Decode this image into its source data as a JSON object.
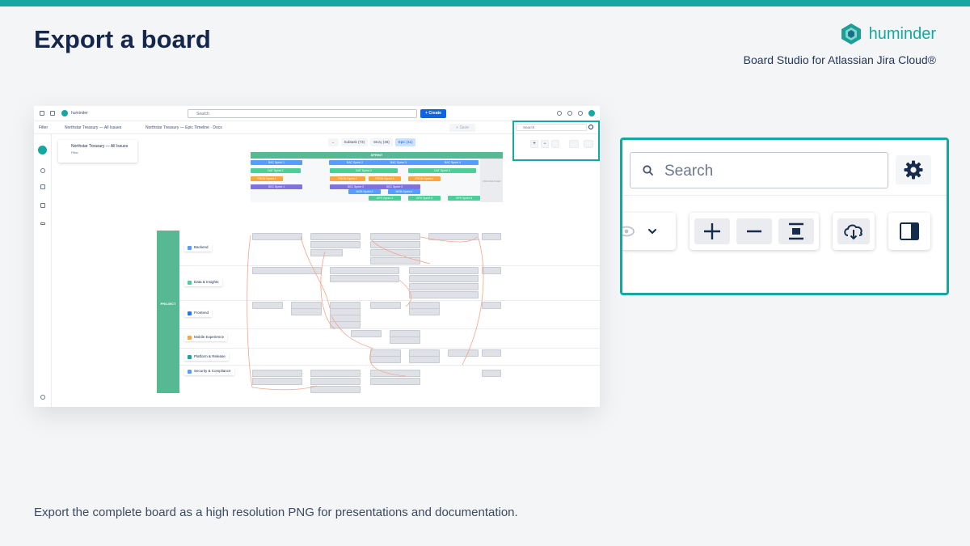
{
  "page": {
    "title": "Export a board",
    "brand": "huminder",
    "subtitle": "Board Studio for Atlassian Jira Cloud®",
    "footer": "Export the complete board as a high resolution PNG for presentations and documentation."
  },
  "app": {
    "name": "huminder",
    "search_placeholder": "Search",
    "create_label": "+ Create",
    "filter_label": "Filter",
    "filter_source": "Northstar Treasury — All Issues",
    "board_name": "Northstar Treasury — Epic Timeline · Docs",
    "save_label": "+ Save",
    "filter_card_title": "Northstar Treasury — All Issues",
    "filter_card_sub": "Filter"
  },
  "type_chips": [
    {
      "label": "Subtask (73)"
    },
    {
      "label": "Story (48)"
    },
    {
      "label": "Epic (11)"
    }
  ],
  "mini_toolbar": {
    "search_placeholder": "Search",
    "plus": "+",
    "minus": "−"
  },
  "timeline": {
    "header": "SPRINT",
    "unscheduled": "UNSCHEDULED",
    "sprints": [
      {
        "label": "BAC Sprint 1",
        "color": "#579dff"
      },
      {
        "label": "BAC Sprint 2",
        "color": "#579dff"
      },
      {
        "label": "BAC Sprint 3",
        "color": "#579dff"
      },
      {
        "label": "BAC Sprint 4",
        "color": "#579dff"
      },
      {
        "label": "DAT Sprint 1",
        "color": "#4bce97"
      },
      {
        "label": "DAT Sprint 2",
        "color": "#4bce97"
      },
      {
        "label": "DAT Sprint 3",
        "color": "#4bce97"
      },
      {
        "label": "FRON Sprint 1",
        "color": "#faa53d"
      },
      {
        "label": "FRON Sprint 2",
        "color": "#faa53d"
      },
      {
        "label": "FRON Sprint 3",
        "color": "#faa53d"
      },
      {
        "label": "FRON Sprint 4",
        "color": "#faa53d"
      },
      {
        "label": "SEC Sprint 1",
        "color": "#8270db"
      },
      {
        "label": "SEC Sprint 2",
        "color": "#8270db"
      },
      {
        "label": "SEC Sprint 3",
        "color": "#8270db"
      },
      {
        "label": "MOB Sprint 3",
        "color": "#579dff"
      },
      {
        "label": "MOB Sprint 4",
        "color": "#579dff"
      },
      {
        "label": "OPS Sprint 4",
        "color": "#4bce97"
      },
      {
        "label": "OPS Sprint 5",
        "color": "#4bce97"
      },
      {
        "label": "OPS Sprint 6",
        "color": "#4bce97"
      }
    ]
  },
  "lanes": {
    "column_label": "PROJECT",
    "items": [
      {
        "label": "Backend",
        "color": "#579dff"
      },
      {
        "label": "Data & Insights",
        "color": "#4bce97"
      },
      {
        "label": "Frontend",
        "color": "#1d7afc"
      },
      {
        "label": "Mobile Experience",
        "color": "#faa53d"
      },
      {
        "label": "Platform & Release",
        "color": "#16a8a0"
      },
      {
        "label": "Security & Compliance",
        "color": "#579dff"
      }
    ]
  },
  "zoom": {
    "search_placeholder": "Search"
  },
  "colors": {
    "accent": "#16a8a0",
    "title": "#14264a",
    "create": "#0c66e4"
  }
}
